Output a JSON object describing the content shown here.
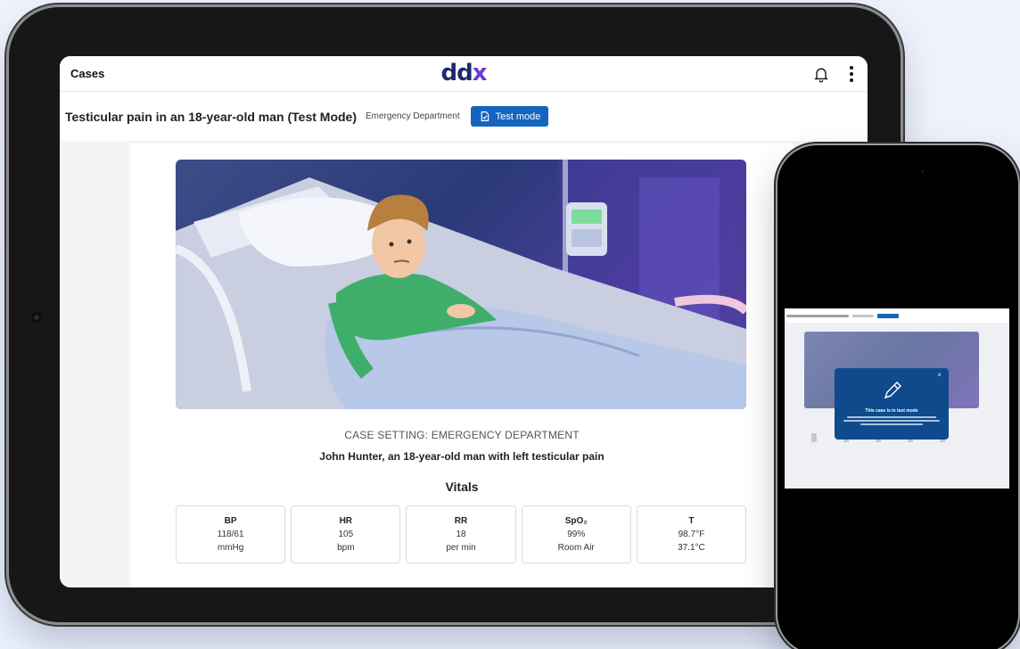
{
  "header": {
    "cases_label": "Cases",
    "logo_left": "dd",
    "logo_right": "x"
  },
  "titlebar": {
    "title": "Testicular pain in an 18-year-old man (Test Mode)",
    "department": "Emergency Department",
    "test_mode_label": "Test mode"
  },
  "case": {
    "setting": "CASE SETTING: EMERGENCY DEPARTMENT",
    "summary": "John Hunter, an 18-year-old man with left testicular pain",
    "vitals_heading": "Vitals"
  },
  "vitals": [
    {
      "label": "BP",
      "value": "118/61",
      "unit": "mmHg"
    },
    {
      "label": "HR",
      "value": "105",
      "unit": "bpm"
    },
    {
      "label": "RR",
      "value": "18",
      "unit": "per min"
    },
    {
      "label": "SpO₂",
      "value": "99%",
      "unit": "Room Air"
    },
    {
      "label": "T",
      "value": "98.7°F",
      "unit": "37.1°C"
    }
  ],
  "phone_modal": {
    "title": "This case is in test mode",
    "close": "×"
  },
  "colors": {
    "accent": "#1565c0",
    "logo_dark": "#1d2a6b",
    "logo_purple": "#6a3bd6",
    "modal_bg": "#0f4a8c"
  },
  "icons": [
    "bell-icon",
    "more-vertical-icon",
    "test-mode-icon",
    "pencil-icon",
    "close-icon"
  ]
}
